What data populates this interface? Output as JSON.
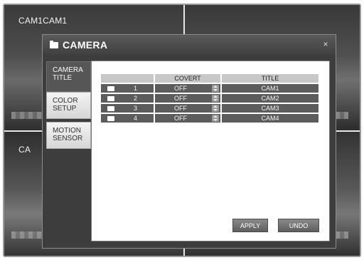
{
  "background": {
    "labels": [
      "CAM1CAM1",
      "CA"
    ]
  },
  "dialog": {
    "title": "CAMERA",
    "close_glyph": "×"
  },
  "tabs": [
    {
      "label_line1": "CAMERA",
      "label_line2": "TITLE",
      "selected": true
    },
    {
      "label_line1": "COLOR",
      "label_line2": "SETUP",
      "selected": false
    },
    {
      "label_line1": "MOTION",
      "label_line2": "SENSOR",
      "selected": false
    }
  ],
  "table": {
    "headers": {
      "number": "",
      "covert": "COVERT",
      "title": "TITLE"
    },
    "rows": [
      {
        "number": "1",
        "covert": "OFF",
        "title": "CAM1"
      },
      {
        "number": "2",
        "covert": "OFF",
        "title": "CAM2"
      },
      {
        "number": "3",
        "covert": "OFF",
        "title": "CAM3"
      },
      {
        "number": "4",
        "covert": "OFF",
        "title": "CAM4"
      }
    ]
  },
  "buttons": {
    "apply": "APPLY",
    "undo": "UNDO"
  },
  "colors": {
    "dialog_bg": "#3d3d3d",
    "panel_bg": "#ffffff",
    "row_bg": "#5c5c5c",
    "header_bg": "#c8c8c8"
  }
}
